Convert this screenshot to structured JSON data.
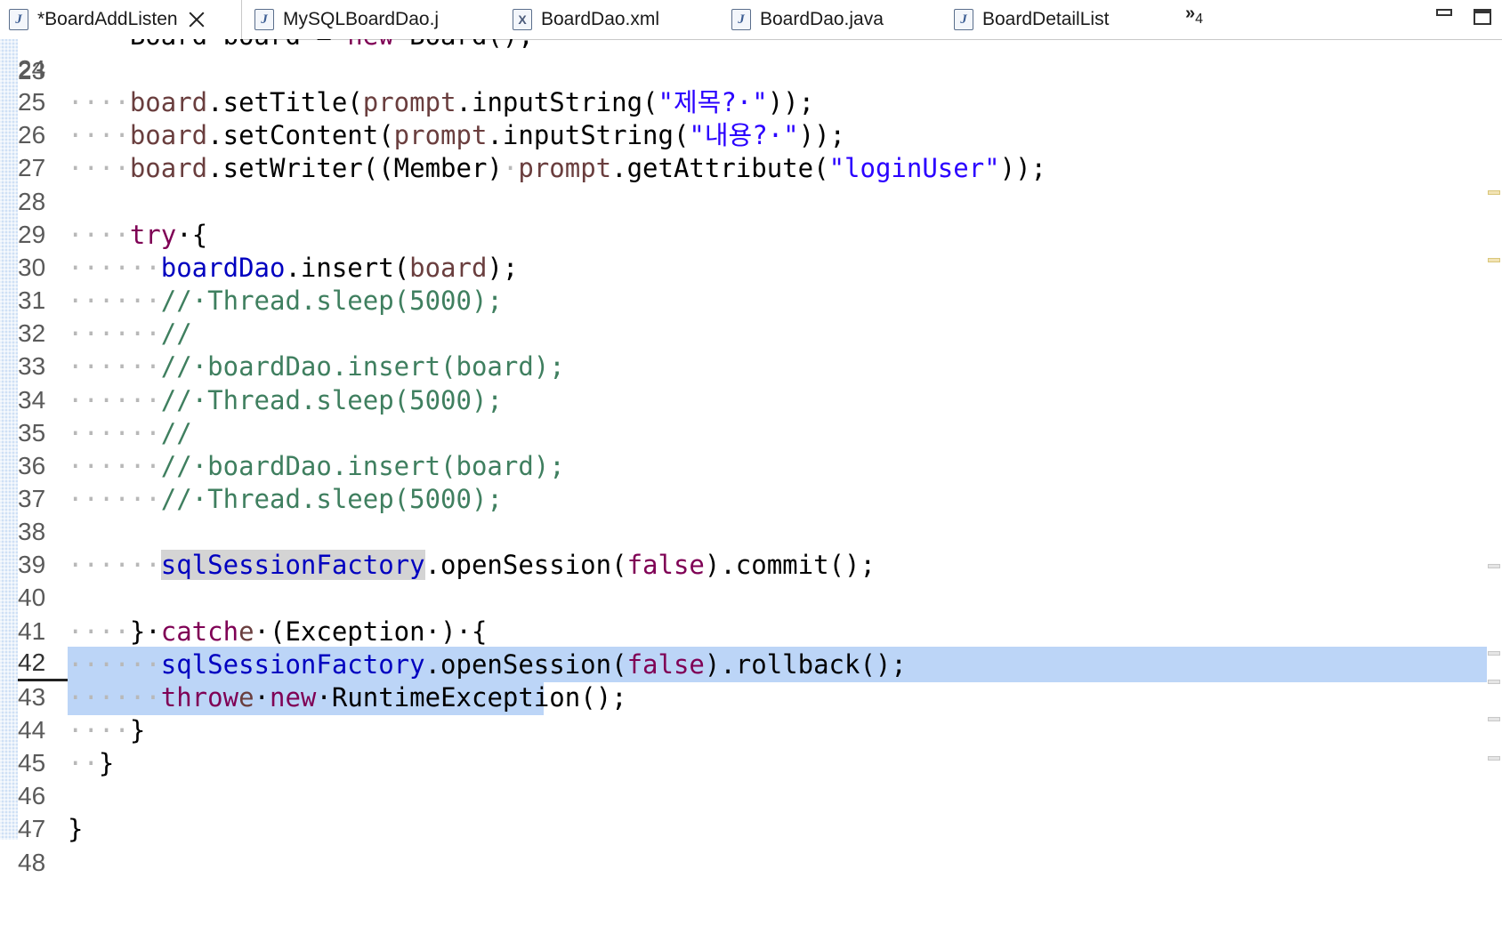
{
  "tabs": [
    {
      "label": "*BoardAddListen",
      "icon": "java-file-icon",
      "active": true
    },
    {
      "label": "MySQLBoardDao.j",
      "icon": "java-file-icon"
    },
    {
      "label": "BoardDao.xml",
      "icon": "xml-file-icon"
    },
    {
      "label": "BoardDao.java",
      "icon": "java-file-icon"
    },
    {
      "label": "BoardDetailList",
      "icon": "java-file-icon"
    }
  ],
  "overflow": {
    "glyph": "»",
    "count": "4"
  },
  "editor": {
    "current_line": "42",
    "lines": [
      {
        "n": "24"
      },
      {
        "n": "25",
        "ws": "····",
        "a": "board",
        "b": ".setTitle(",
        "c": "prompt",
        "d": ".inputString(",
        "e": "\"제목?·\"",
        "f": "));"
      },
      {
        "n": "26",
        "ws": "····",
        "a": "board",
        "b": ".setContent(",
        "c": "prompt",
        "d": ".inputString(",
        "e": "\"내용?·\"",
        "f": "));"
      },
      {
        "n": "27",
        "ws": "····",
        "a": "board",
        "b": ".setWriter((Member)",
        "ws2": "·",
        "c": "prompt",
        "d": ".getAttribute(",
        "e": "\"loginUser\"",
        "f": "));"
      },
      {
        "n": "28"
      },
      {
        "n": "29",
        "ws": "····",
        "kw": "try",
        "rest": "·{"
      },
      {
        "n": "30",
        "ws": "······",
        "fld": "boardDao",
        "b": ".insert(",
        "c": "board",
        "f": ");"
      },
      {
        "n": "31",
        "ws": "······",
        "cmt": "//·Thread.sleep(5000);"
      },
      {
        "n": "32",
        "ws": "······",
        "cmt": "//"
      },
      {
        "n": "33",
        "ws": "······",
        "cmt": "//·boardDao.insert(board);"
      },
      {
        "n": "34",
        "ws": "······",
        "cmt": "//·Thread.sleep(5000);"
      },
      {
        "n": "35",
        "ws": "······",
        "cmt": "//"
      },
      {
        "n": "36",
        "ws": "······",
        "cmt": "//·boardDao.insert(board);"
      },
      {
        "n": "37",
        "ws": "······",
        "cmt": "//·Thread.sleep(5000);"
      },
      {
        "n": "38"
      },
      {
        "n": "39",
        "ws": "······",
        "fld": "sqlSessionFactory",
        "b": ".openSession(",
        "kw2": "false",
        "f": ").commit();"
      },
      {
        "n": "40"
      },
      {
        "n": "41",
        "ws": "····",
        "b": "}·",
        "kw2": "catch",
        "f": "·(Exception·",
        "c": "e",
        "g": ")·{"
      },
      {
        "n": "42",
        "ws": "······",
        "fld": "sqlSessionFactory",
        "b": ".openSession(",
        "kw2": "false",
        "f": ").rollback();"
      },
      {
        "n": "43",
        "ws": "······",
        "kw2": "throw",
        "f": "·",
        "kw3": "new",
        "g": "·RuntimeException(",
        "c": "e",
        "h": ");"
      },
      {
        "n": "44",
        "ws": "····",
        "b": "}"
      },
      {
        "n": "45",
        "ws": "··",
        "b": "}"
      },
      {
        "n": "46"
      },
      {
        "n": "47",
        "b": "}"
      },
      {
        "n": "48"
      }
    ]
  },
  "colors": {
    "keyword": "#7f0055",
    "string": "#2a00ff",
    "comment": "#3f7f5f",
    "field": "#0000c0",
    "local": "#6a3e3e",
    "selection": "#bcd5f7"
  }
}
